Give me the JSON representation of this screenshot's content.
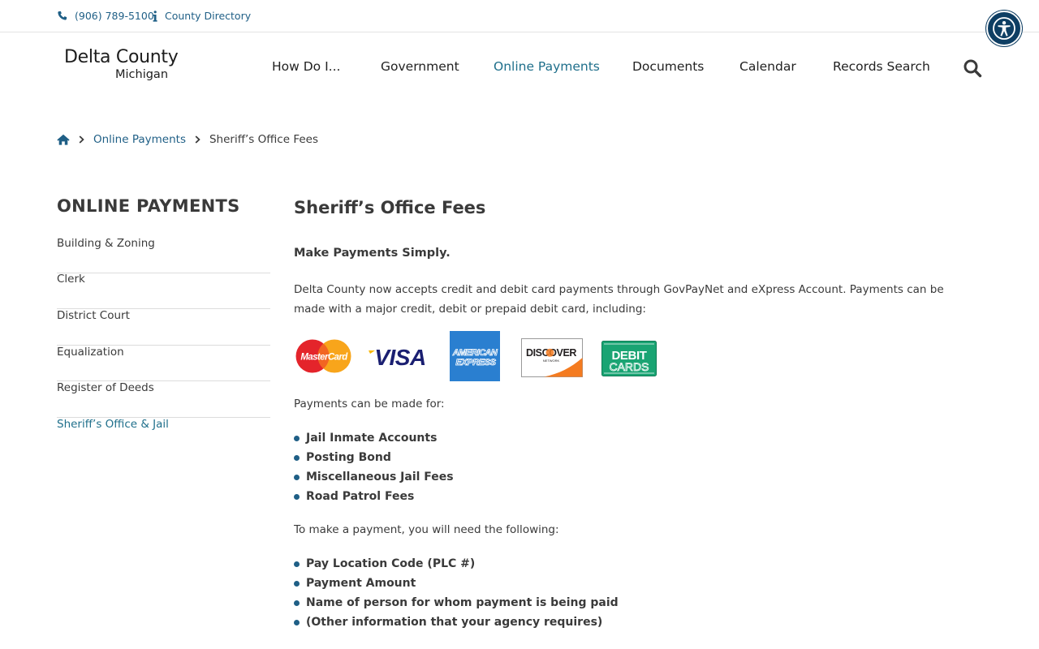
{
  "topbar": {
    "phone": "(906) 789-5100",
    "directory": "County Directory"
  },
  "logo": {
    "line1": "Delta County",
    "line2": "Michigan"
  },
  "nav": {
    "items": [
      {
        "label": "How Do I..."
      },
      {
        "label": "Government"
      },
      {
        "label": "Online Payments"
      },
      {
        "label": "Documents"
      },
      {
        "label": "Calendar"
      },
      {
        "label": "Records Search"
      }
    ],
    "active": "Online Payments"
  },
  "breadcrumb": {
    "link": "Online Payments",
    "current": "Sheriff’s Office Fees"
  },
  "sidebar": {
    "title": "ONLINE PAYMENTS",
    "items": [
      {
        "label": "Building & Zoning"
      },
      {
        "label": "Clerk"
      },
      {
        "label": "District Court"
      },
      {
        "label": "Equalization"
      },
      {
        "label": "Register of Deeds"
      },
      {
        "label": "Sheriff’s Office & Jail"
      }
    ]
  },
  "main": {
    "title": "Sheriff’s Office Fees",
    "subhead": "Make Payments Simply.",
    "intro": "Delta County now accepts credit and debit card payments through GovPayNet and eXpress Account. Payments can be made with a major credit, debit or prepaid debit card, including:",
    "cards": {
      "mastercard": "MasterCard",
      "visa": "VISA",
      "amex_line1": "AMERICAN",
      "amex_line2": "EXPRESS",
      "discover": "DISCOVER",
      "discover_sub": "NETWORK",
      "debit_line1": "DEBIT",
      "debit_line2": "CARDS"
    },
    "payments_for_label": "Payments can be made for:",
    "payments_for": [
      "Jail Inmate Accounts",
      "Posting Bond",
      "Miscellaneous Jail Fees",
      "Road Patrol Fees"
    ],
    "need_label": "To make a payment, you will need the following:",
    "need_items": [
      "Pay Location Code (PLC #)",
      "Payment Amount",
      "Name of person for whom payment is being paid",
      "(Other information that your agency requires)"
    ]
  },
  "colors": {
    "link": "#1f5f86",
    "active_nav": "#1f6f8b",
    "a11y_bg": "#0e3e63"
  }
}
